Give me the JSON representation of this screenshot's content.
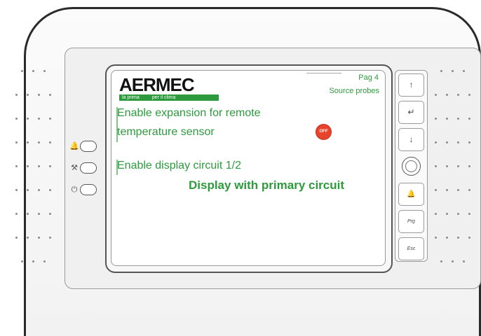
{
  "brand": {
    "logo_text": "AERMEC",
    "tagline_left": "la prima",
    "tagline_right": "per il clima"
  },
  "header": {
    "page": "Pag 4",
    "section": "Source probes"
  },
  "settings": [
    {
      "label_line1": "Enable expansion for remote",
      "label_line2": "temperature sensor",
      "value": "OFF"
    },
    {
      "label": "Enable display circuit 1/2",
      "value": "Display with primary circuit"
    }
  ],
  "leds": [
    {
      "icon": "bell-icon",
      "glyph": "🔔"
    },
    {
      "icon": "wrench-icon",
      "glyph": "⚒"
    },
    {
      "icon": "power-icon",
      "glyph": "⏻"
    }
  ],
  "keypad": {
    "up": "↑",
    "enter": "↵",
    "down": "↓",
    "alarm": "🔔",
    "prg": "Prg",
    "esc": "Esc"
  },
  "colors": {
    "text_green": "#2d9a3d",
    "off_red": "#e8432b"
  }
}
